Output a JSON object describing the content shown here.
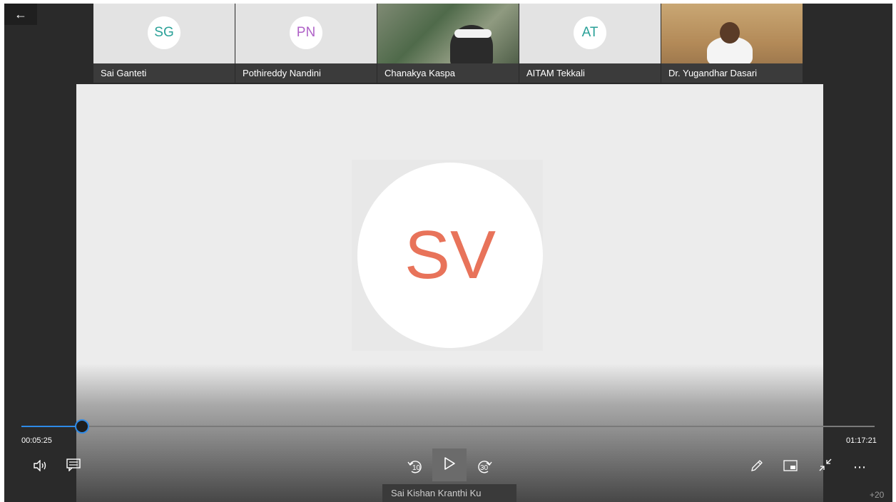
{
  "thumbnails": [
    {
      "initials": "SG",
      "name": "Sai Ganteti",
      "color": "#2aa198"
    },
    {
      "initials": "PN",
      "name": "Pothireddy Nandini",
      "color": "#b063c8"
    },
    {
      "name": "Chanakya Kaspa"
    },
    {
      "initials": "AT",
      "name": "AITAM Tekkali",
      "color": "#2aa198"
    },
    {
      "name": "Dr. Yugandhar Dasari"
    }
  ],
  "active_speaker": {
    "initials": "SV",
    "color": "#e8735a"
  },
  "player": {
    "current_time": "00:05:25",
    "total_time": "01:17:21",
    "progress": 0.07,
    "skip_back_label": "10",
    "skip_forward_label": "30"
  },
  "tooltip_text": "Sai Kishan Kranthi Ku",
  "overflow_count": "+20",
  "colors": {
    "accent": "#2e8ae6",
    "background": "#2a2a2a",
    "stage": "#ececec"
  }
}
